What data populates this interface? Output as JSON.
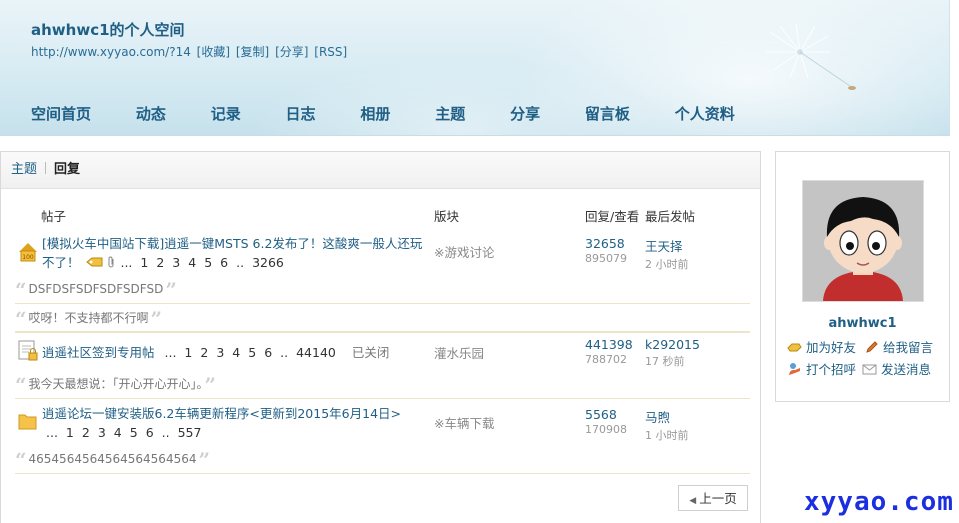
{
  "header": {
    "space_name": "ahwhwc1的个人空间",
    "url": "http://www.xyyao.com/?14",
    "links": [
      "[收藏]",
      "[复制]",
      "[分享]",
      "[RSS]"
    ],
    "nav": [
      "空间首页",
      "动态",
      "记录",
      "日志",
      "相册",
      "主题",
      "分享",
      "留言板",
      "个人资料"
    ]
  },
  "tabs": {
    "topics": "主题",
    "replies": "回复"
  },
  "columns": {
    "post": "帖子",
    "forum": "版块",
    "replies_views": "回复/查看",
    "last_post": "最后发帖"
  },
  "threads": [
    {
      "title": "[模拟火车中国站下载]逍遥一键MSTS 6.2发布了！这酸爽一般人还玩不了！",
      "pages": [
        "...",
        "1",
        "2",
        "3",
        "4",
        "5",
        "6",
        "..",
        "3266"
      ],
      "forum": "※游戏讨论",
      "replies": "32658",
      "views": "895079",
      "last_user": "王天择",
      "last_time": "2 小时前",
      "quotes": [
        "DSFDSFSDFSDFSDFSD",
        "哎呀！不支持都不行啊"
      ]
    },
    {
      "title": "逍遥社区签到专用帖",
      "pages": [
        "...",
        "1",
        "2",
        "3",
        "4",
        "5",
        "6",
        "..",
        "44140"
      ],
      "status": "已关闭",
      "forum": "灌水乐园",
      "replies": "441398",
      "views": "788702",
      "last_user": "k292015",
      "last_time": "17 秒前",
      "quotes": [
        "我今天最想说：「开心开心开心」。"
      ]
    },
    {
      "title": "逍遥论坛一键安装版6.2车辆更新程序<更新到2015年6月14日>",
      "pages": [
        "...",
        "1",
        "2",
        "3",
        "4",
        "5",
        "6",
        "..",
        "557"
      ],
      "forum": "※车辆下载",
      "replies": "5568",
      "views": "170908",
      "last_user": "马煦",
      "last_time": "1 小时前",
      "quotes": [
        "4654564564564564564564"
      ]
    }
  ],
  "pager": {
    "prev": "上一页"
  },
  "sidebar": {
    "username": "ahwhwc1",
    "actions": [
      "加为好友",
      "给我留言",
      "打个招呼",
      "发送消息"
    ]
  },
  "watermark": "xyyao.com",
  "colors": {
    "link": "#1f5f85",
    "accent_border": "#ece5c8",
    "watermark": "#1b2fe0"
  }
}
